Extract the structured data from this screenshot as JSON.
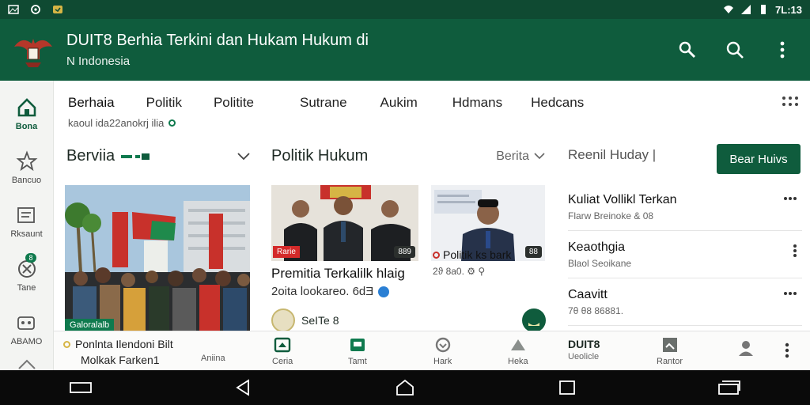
{
  "status_bar": {
    "time": "7L:13"
  },
  "app_bar": {
    "title": "DUIT8 Berhia Terkini dan Hukam Hukum di",
    "subtitle": "N Indonesia",
    "actions": [
      "tools-icon",
      "search-icon",
      "more-vert-icon"
    ]
  },
  "side_rail": {
    "items": [
      {
        "label": "Bona",
        "icon": "home-icon",
        "active": true
      },
      {
        "label": "Bancuo",
        "icon": "star-icon"
      },
      {
        "label": "Rksaunt",
        "icon": "list-icon"
      },
      {
        "label": "Tane",
        "icon": "settings-icon",
        "badge": "8"
      },
      {
        "label": "ABAMO",
        "icon": "game-icon"
      }
    ]
  },
  "tabs": {
    "items": [
      "Berhaia",
      "Politik",
      "Politite",
      "Sutrane",
      "Aukim",
      "Hdmans",
      "Hedcans"
    ],
    "sub": "kaoul ida22anokrj ilia"
  },
  "column1": {
    "heading": "Berviia",
    "tag": "Galoralalb"
  },
  "column2": {
    "heading": "Politik Hukum",
    "filter": "Berita"
  },
  "column3": {
    "heading": "Reenil Huday |",
    "cta": "Bear Huivs"
  },
  "story2": {
    "tag": "Rarie",
    "badge": "889",
    "title": "Premitia Terkalilk hlaig",
    "meta": "2oita lookareo. 6dƎ",
    "author": "SeITe 8"
  },
  "story3": {
    "title": "Politik ks bark",
    "badge": "88",
    "meta": "2ϑ 8a0. ⚙ ⚲"
  },
  "trending": [
    {
      "title": "Kuliat Vollikl Terkan",
      "meta": "Flarw Breinoke  & 08"
    },
    {
      "title": "Keaothgia",
      "meta": "Blaol Seoikane"
    },
    {
      "title": "Caavitt",
      "meta": "7θ θ8 86881."
    }
  ],
  "bottom_nav": {
    "first": {
      "line1": "Ponlnta Ilendoni Bilt",
      "line2": "Molkak Farken1"
    },
    "items": [
      {
        "label": "Aniina",
        "icon": ""
      },
      {
        "label": "Ceria",
        "icon": "news-icon"
      },
      {
        "label": "Tamt",
        "icon": "tv-icon"
      },
      {
        "label": "Hark",
        "icon": "heart-icon"
      },
      {
        "label": "Heka",
        "icon": "triangle-icon"
      },
      {
        "label": "Rantor",
        "icon": "grid-icon"
      }
    ],
    "brand": {
      "name": "DUIT8",
      "sub": "Ueolicle"
    }
  },
  "colors": {
    "primary": "#0f5c3d",
    "status": "#0f4a32",
    "accent_red": "#d42a2a"
  }
}
